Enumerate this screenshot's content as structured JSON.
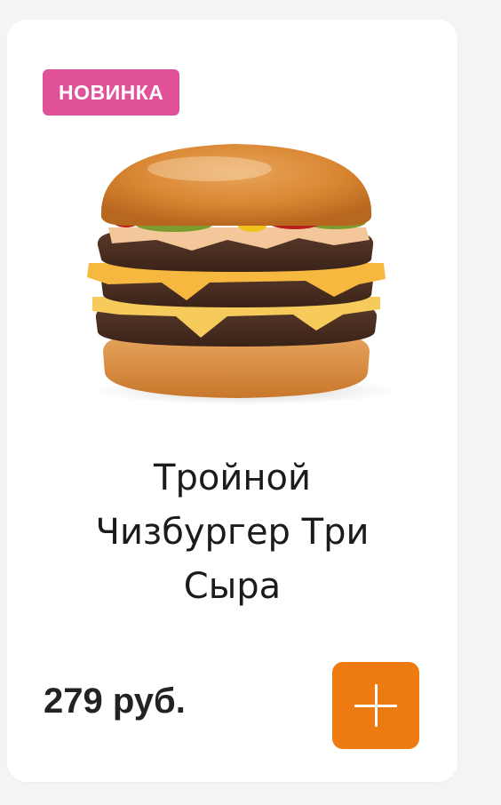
{
  "product": {
    "badge": "НОВИНКА",
    "title_lines": [
      "Тройной",
      "Чизбургер Три",
      "Сыра"
    ],
    "price": "279 руб.",
    "image_alt": "triple-cheeseburger-image"
  },
  "actions": {
    "add_icon": "plus-icon"
  },
  "colors": {
    "badge_bg": "#e0519a",
    "add_button_bg": "#ee7a12",
    "card_bg": "#ffffff",
    "page_bg": "#f4f4f5"
  }
}
